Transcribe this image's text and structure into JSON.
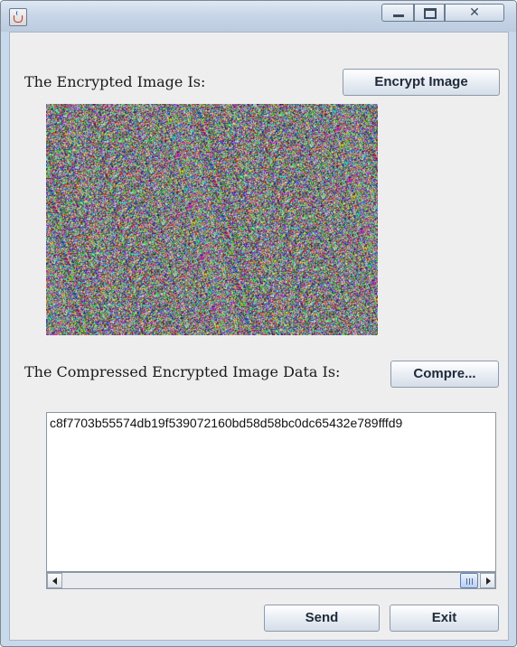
{
  "window": {
    "icon": "java-icon",
    "controls": [
      "minimize-icon",
      "maximize-icon",
      "close-icon"
    ]
  },
  "encrypted": {
    "label": "The Encrypted Image Is:",
    "button_label": "Encrypt Image"
  },
  "compressed": {
    "label": "The Compressed Encrypted Image Data Is:",
    "button_label": "Compre...",
    "text_value": "c8f7703b55574db19f539072160bd58d58bc0dc65432e789fffd9"
  },
  "footer": {
    "send_label": "Send",
    "exit_label": "Exit"
  }
}
